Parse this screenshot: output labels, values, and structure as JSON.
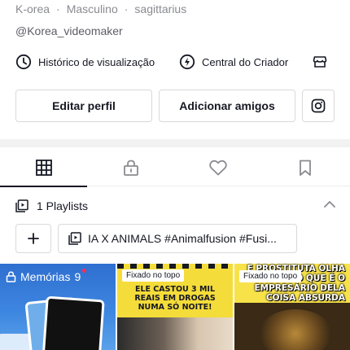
{
  "profile": {
    "meta": [
      "K-orea",
      "Masculino",
      "sagittarius"
    ],
    "handle": "@Korea_videomaker"
  },
  "links": {
    "history": "Histórico de visualização",
    "creator_center": "Central do Criador"
  },
  "actions": {
    "edit_profile": "Editar perfil",
    "add_friends": "Adicionar amigos"
  },
  "playlists": {
    "header": "1 Playlists",
    "items": [
      "IA X ANIMALS #Animalfusion #Fusi..."
    ]
  },
  "grid": {
    "memories_label": "Memórias",
    "memories_count": "9",
    "pinned_label": "Fixado no topo",
    "tile2_caption": "ELE CASTOU 3 MIL REAIS EM DROGAS NUMA SÓ NOITE!",
    "tile3_caption": "E PROSTITUTA OLHA SÓ QUE É O EMPRESÁRIO DELA COISA ABSURDA"
  }
}
